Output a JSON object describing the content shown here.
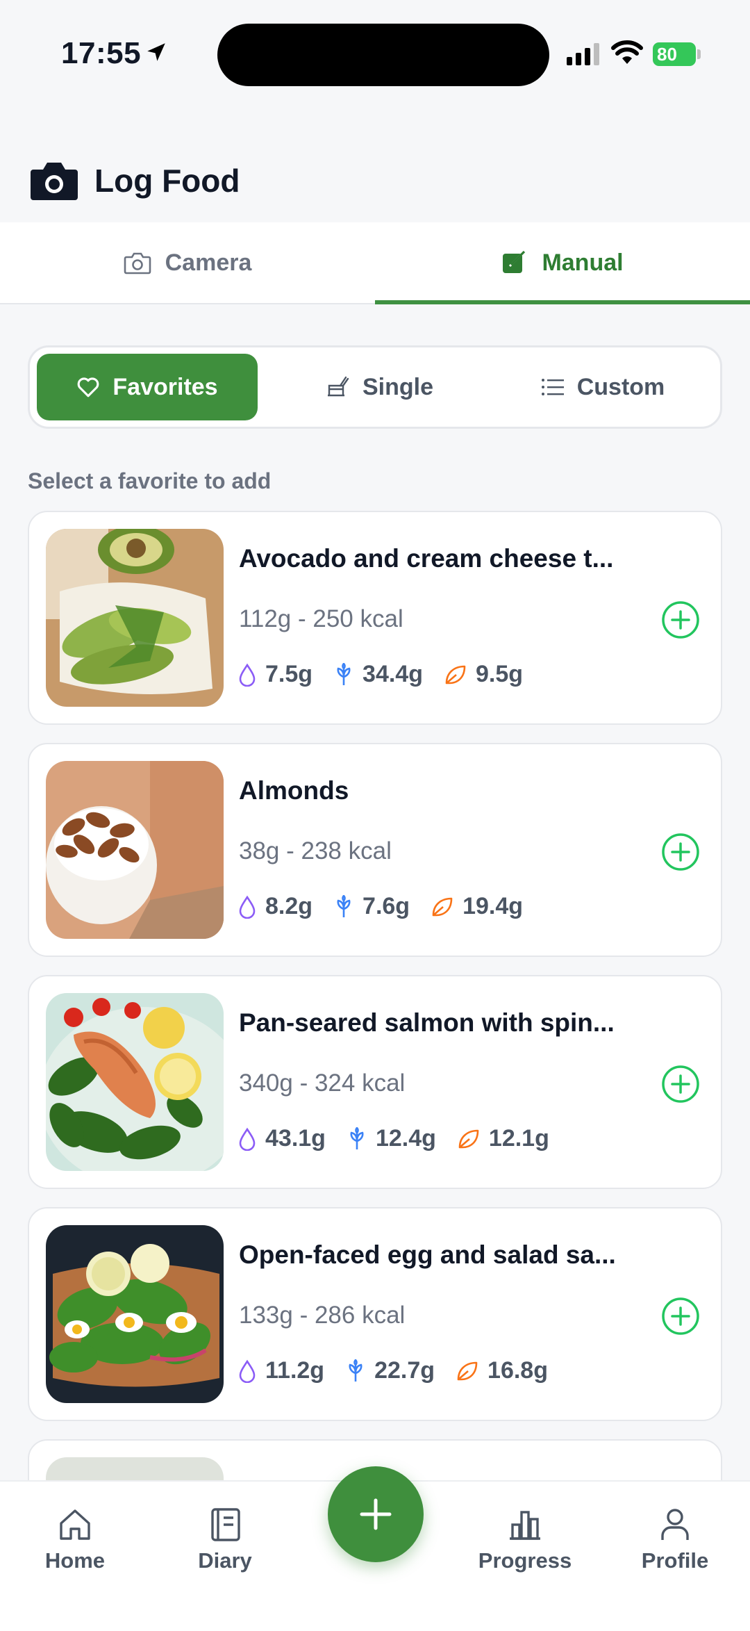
{
  "status_bar": {
    "time": "17:55",
    "battery": "80"
  },
  "header": {
    "title": "Log Food",
    "icon": "camera-icon"
  },
  "top_tabs": [
    {
      "label": "Camera",
      "icon": "camera-outline-icon",
      "active": false
    },
    {
      "label": "Manual",
      "icon": "edit-note-icon",
      "active": true
    }
  ],
  "segment": {
    "favorites": "Favorites",
    "single": "Single",
    "custom": "Custom"
  },
  "section_label": "Select a favorite to add",
  "foods": [
    {
      "name": "Avocado and cream cheese t...",
      "meta": "112g - 250 kcal",
      "protein": "7.5g",
      "carbs": "34.4g",
      "fat": "9.5g"
    },
    {
      "name": "Almonds",
      "meta": "38g - 238 kcal",
      "protein": "8.2g",
      "carbs": "7.6g",
      "fat": "19.4g"
    },
    {
      "name": "Pan-seared salmon with spin...",
      "meta": "340g - 324 kcal",
      "protein": "43.1g",
      "carbs": "12.4g",
      "fat": "12.1g"
    },
    {
      "name": "Open-faced egg and salad sa...",
      "meta": "133g - 286 kcal",
      "protein": "11.2g",
      "carbs": "22.7g",
      "fat": "16.8g"
    }
  ],
  "bottom_nav": {
    "home": "Home",
    "diary": "Diary",
    "progress": "Progress",
    "profile": "Profile"
  },
  "colors": {
    "accent": "#3f8f3d",
    "add_icon": "#22c55e",
    "protein": "#8b5cf6",
    "carbs": "#3b82f6",
    "fat": "#f97316"
  }
}
